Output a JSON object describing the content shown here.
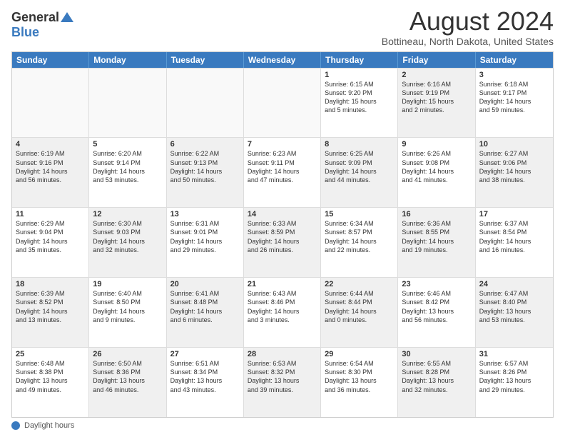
{
  "logo": {
    "general": "General",
    "blue": "Blue"
  },
  "title": "August 2024",
  "subtitle": "Bottineau, North Dakota, United States",
  "days_of_week": [
    "Sunday",
    "Monday",
    "Tuesday",
    "Wednesday",
    "Thursday",
    "Friday",
    "Saturday"
  ],
  "footer_label": "Daylight hours",
  "weeks": [
    [
      {
        "day": "",
        "info": "",
        "shaded": false
      },
      {
        "day": "",
        "info": "",
        "shaded": false
      },
      {
        "day": "",
        "info": "",
        "shaded": false
      },
      {
        "day": "",
        "info": "",
        "shaded": false
      },
      {
        "day": "1",
        "info": "Sunrise: 6:15 AM\nSunset: 9:20 PM\nDaylight: 15 hours\nand 5 minutes.",
        "shaded": false
      },
      {
        "day": "2",
        "info": "Sunrise: 6:16 AM\nSunset: 9:19 PM\nDaylight: 15 hours\nand 2 minutes.",
        "shaded": true
      },
      {
        "day": "3",
        "info": "Sunrise: 6:18 AM\nSunset: 9:17 PM\nDaylight: 14 hours\nand 59 minutes.",
        "shaded": false
      }
    ],
    [
      {
        "day": "4",
        "info": "Sunrise: 6:19 AM\nSunset: 9:16 PM\nDaylight: 14 hours\nand 56 minutes.",
        "shaded": true
      },
      {
        "day": "5",
        "info": "Sunrise: 6:20 AM\nSunset: 9:14 PM\nDaylight: 14 hours\nand 53 minutes.",
        "shaded": false
      },
      {
        "day": "6",
        "info": "Sunrise: 6:22 AM\nSunset: 9:13 PM\nDaylight: 14 hours\nand 50 minutes.",
        "shaded": true
      },
      {
        "day": "7",
        "info": "Sunrise: 6:23 AM\nSunset: 9:11 PM\nDaylight: 14 hours\nand 47 minutes.",
        "shaded": false
      },
      {
        "day": "8",
        "info": "Sunrise: 6:25 AM\nSunset: 9:09 PM\nDaylight: 14 hours\nand 44 minutes.",
        "shaded": true
      },
      {
        "day": "9",
        "info": "Sunrise: 6:26 AM\nSunset: 9:08 PM\nDaylight: 14 hours\nand 41 minutes.",
        "shaded": false
      },
      {
        "day": "10",
        "info": "Sunrise: 6:27 AM\nSunset: 9:06 PM\nDaylight: 14 hours\nand 38 minutes.",
        "shaded": true
      }
    ],
    [
      {
        "day": "11",
        "info": "Sunrise: 6:29 AM\nSunset: 9:04 PM\nDaylight: 14 hours\nand 35 minutes.",
        "shaded": false
      },
      {
        "day": "12",
        "info": "Sunrise: 6:30 AM\nSunset: 9:03 PM\nDaylight: 14 hours\nand 32 minutes.",
        "shaded": true
      },
      {
        "day": "13",
        "info": "Sunrise: 6:31 AM\nSunset: 9:01 PM\nDaylight: 14 hours\nand 29 minutes.",
        "shaded": false
      },
      {
        "day": "14",
        "info": "Sunrise: 6:33 AM\nSunset: 8:59 PM\nDaylight: 14 hours\nand 26 minutes.",
        "shaded": true
      },
      {
        "day": "15",
        "info": "Sunrise: 6:34 AM\nSunset: 8:57 PM\nDaylight: 14 hours\nand 22 minutes.",
        "shaded": false
      },
      {
        "day": "16",
        "info": "Sunrise: 6:36 AM\nSunset: 8:55 PM\nDaylight: 14 hours\nand 19 minutes.",
        "shaded": true
      },
      {
        "day": "17",
        "info": "Sunrise: 6:37 AM\nSunset: 8:54 PM\nDaylight: 14 hours\nand 16 minutes.",
        "shaded": false
      }
    ],
    [
      {
        "day": "18",
        "info": "Sunrise: 6:39 AM\nSunset: 8:52 PM\nDaylight: 14 hours\nand 13 minutes.",
        "shaded": true
      },
      {
        "day": "19",
        "info": "Sunrise: 6:40 AM\nSunset: 8:50 PM\nDaylight: 14 hours\nand 9 minutes.",
        "shaded": false
      },
      {
        "day": "20",
        "info": "Sunrise: 6:41 AM\nSunset: 8:48 PM\nDaylight: 14 hours\nand 6 minutes.",
        "shaded": true
      },
      {
        "day": "21",
        "info": "Sunrise: 6:43 AM\nSunset: 8:46 PM\nDaylight: 14 hours\nand 3 minutes.",
        "shaded": false
      },
      {
        "day": "22",
        "info": "Sunrise: 6:44 AM\nSunset: 8:44 PM\nDaylight: 14 hours\nand 0 minutes.",
        "shaded": true
      },
      {
        "day": "23",
        "info": "Sunrise: 6:46 AM\nSunset: 8:42 PM\nDaylight: 13 hours\nand 56 minutes.",
        "shaded": false
      },
      {
        "day": "24",
        "info": "Sunrise: 6:47 AM\nSunset: 8:40 PM\nDaylight: 13 hours\nand 53 minutes.",
        "shaded": true
      }
    ],
    [
      {
        "day": "25",
        "info": "Sunrise: 6:48 AM\nSunset: 8:38 PM\nDaylight: 13 hours\nand 49 minutes.",
        "shaded": false
      },
      {
        "day": "26",
        "info": "Sunrise: 6:50 AM\nSunset: 8:36 PM\nDaylight: 13 hours\nand 46 minutes.",
        "shaded": true
      },
      {
        "day": "27",
        "info": "Sunrise: 6:51 AM\nSunset: 8:34 PM\nDaylight: 13 hours\nand 43 minutes.",
        "shaded": false
      },
      {
        "day": "28",
        "info": "Sunrise: 6:53 AM\nSunset: 8:32 PM\nDaylight: 13 hours\nand 39 minutes.",
        "shaded": true
      },
      {
        "day": "29",
        "info": "Sunrise: 6:54 AM\nSunset: 8:30 PM\nDaylight: 13 hours\nand 36 minutes.",
        "shaded": false
      },
      {
        "day": "30",
        "info": "Sunrise: 6:55 AM\nSunset: 8:28 PM\nDaylight: 13 hours\nand 32 minutes.",
        "shaded": true
      },
      {
        "day": "31",
        "info": "Sunrise: 6:57 AM\nSunset: 8:26 PM\nDaylight: 13 hours\nand 29 minutes.",
        "shaded": false
      }
    ]
  ]
}
